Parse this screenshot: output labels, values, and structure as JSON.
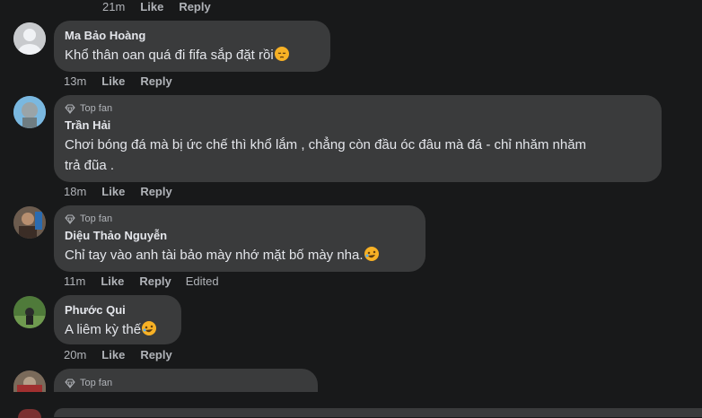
{
  "top_actions": {
    "time": "21m",
    "like": "Like",
    "reply": "Reply"
  },
  "comments": [
    {
      "name": "Ma Bảo Hoàng",
      "text": "Khổ thân oan quá đi fifa sắp đặt rồi",
      "emoji": "pensive-face",
      "time": "13m",
      "like": "Like",
      "reply": "Reply"
    },
    {
      "badge": "Top fan",
      "name": "Trần Hải",
      "text_line1": "Chơi bóng đá mà bị ức chế thì khổ lắm , chẳng còn đầu óc đâu mà đá - chỉ nhăm nhăm",
      "text_line2": "trả đũa .",
      "time": "18m",
      "like": "Like",
      "reply": "Reply"
    },
    {
      "badge": "Top fan",
      "name": "Diệu Thảo Nguyễn",
      "text": "Chỉ tay vào anh tài bảo mày nhớ mặt bố mày nha.",
      "emoji": "rolling-laughing-face",
      "time": "11m",
      "like": "Like",
      "reply": "Reply",
      "edited": "Edited"
    },
    {
      "name": "Phước Qui",
      "text": "A liêm kỳ thế",
      "emoji": "rolling-laughing-face",
      "time": "20m",
      "like": "Like",
      "reply": "Reply"
    },
    {
      "badge": "Top fan"
    }
  ],
  "colors": {
    "background": "#18191a",
    "bubble": "#3a3b3c",
    "text": "#e4e6eb",
    "muted": "#b0b3b8",
    "emoji": "#f7b125"
  },
  "icons": [
    "default-avatar-icon",
    "top-fan-diamond-icon",
    "pensive-face-emoji",
    "rolling-laughing-emoji"
  ]
}
